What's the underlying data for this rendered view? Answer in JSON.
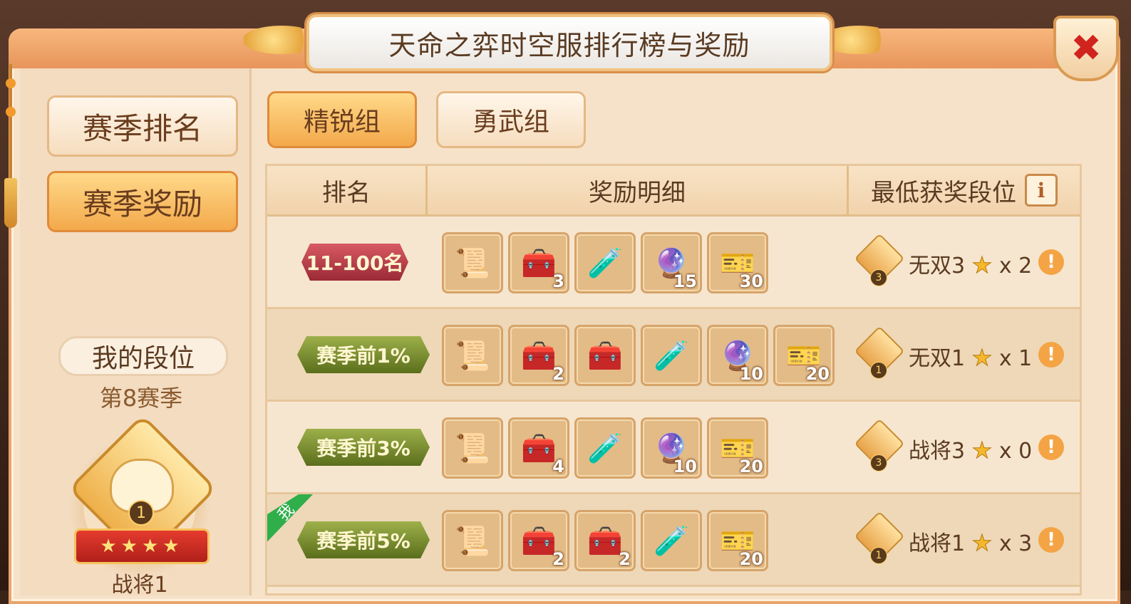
{
  "dialog": {
    "title": "天命之弈时空服排行榜与奖励",
    "close_icon": "✖"
  },
  "sidebar": {
    "items": [
      {
        "label": "赛季排名",
        "active": false
      },
      {
        "label": "赛季奖励",
        "active": true
      }
    ],
    "my_rank_label": "我的段位",
    "season_label": "第8赛季",
    "badge": {
      "number": "1",
      "stars": "★★★★",
      "caption": "战将1"
    }
  },
  "tabs": [
    {
      "label": "精锐组",
      "active": true
    },
    {
      "label": "勇武组",
      "active": false
    }
  ],
  "table": {
    "headers": {
      "rank": "排名",
      "rewards": "奖励明细",
      "min_rank": "最低获奖段位"
    },
    "info_icon": "i",
    "rows": [
      {
        "rank": "11-100名",
        "rank_style": "red",
        "me": false,
        "rewards": [
          {
            "icon": "scroll-icon",
            "glyph": "📜",
            "count": ""
          },
          {
            "icon": "treasure-chest-icon",
            "glyph": "🧰",
            "count": "3"
          },
          {
            "icon": "potion-bottle-icon",
            "glyph": "🧪",
            "count": ""
          },
          {
            "icon": "crystal-ball-icon",
            "glyph": "🔮",
            "count": "15"
          },
          {
            "icon": "red-ticket-icon",
            "glyph": "🎫",
            "count": "30"
          }
        ],
        "min_rank": {
          "badge_number": "3",
          "text": "无双3",
          "star": "★",
          "multiplier": "x 2"
        }
      },
      {
        "rank": "赛季前1%",
        "rank_style": "green",
        "me": false,
        "rewards": [
          {
            "icon": "scroll-icon",
            "glyph": "📜",
            "count": ""
          },
          {
            "icon": "treasure-chest-icon",
            "glyph": "🧰",
            "count": "2"
          },
          {
            "icon": "purple-chest-icon",
            "glyph": "🧰",
            "count": ""
          },
          {
            "icon": "potion-bottle-icon",
            "glyph": "🧪",
            "count": ""
          },
          {
            "icon": "crystal-ball-icon",
            "glyph": "🔮",
            "count": "10"
          },
          {
            "icon": "red-ticket-icon",
            "glyph": "🎫",
            "count": "20"
          }
        ],
        "min_rank": {
          "badge_number": "1",
          "text": "无双1",
          "star": "★",
          "multiplier": "x 1"
        }
      },
      {
        "rank": "赛季前3%",
        "rank_style": "green",
        "me": false,
        "rewards": [
          {
            "icon": "scroll-icon",
            "glyph": "📜",
            "count": ""
          },
          {
            "icon": "purple-chest-icon",
            "glyph": "🧰",
            "count": "4"
          },
          {
            "icon": "potion-bottle-icon",
            "glyph": "🧪",
            "count": ""
          },
          {
            "icon": "crystal-ball-icon",
            "glyph": "🔮",
            "count": "10"
          },
          {
            "icon": "red-ticket-icon",
            "glyph": "🎫",
            "count": "20"
          }
        ],
        "min_rank": {
          "badge_number": "3",
          "text": "战将3",
          "star": "★",
          "multiplier": "x 0"
        }
      },
      {
        "rank": "赛季前5%",
        "rank_style": "green",
        "me": true,
        "me_label": "我",
        "rewards": [
          {
            "icon": "scroll-icon",
            "glyph": "📜",
            "count": ""
          },
          {
            "icon": "purple-chest-icon",
            "glyph": "🧰",
            "count": "2"
          },
          {
            "icon": "silver-chest-icon",
            "glyph": "🧰",
            "count": "2"
          },
          {
            "icon": "potion-bottle-icon",
            "glyph": "🧪",
            "count": ""
          },
          {
            "icon": "red-ticket-icon",
            "glyph": "🎫",
            "count": "20"
          }
        ],
        "min_rank": {
          "badge_number": "1",
          "text": "战将1",
          "star": "★",
          "multiplier": "x 3"
        }
      }
    ]
  },
  "colors": {
    "accent_orange": "#f3a94b",
    "panel": "#f6e2c8",
    "close_red": "#d0241e",
    "me_green": "#2fae4a"
  }
}
